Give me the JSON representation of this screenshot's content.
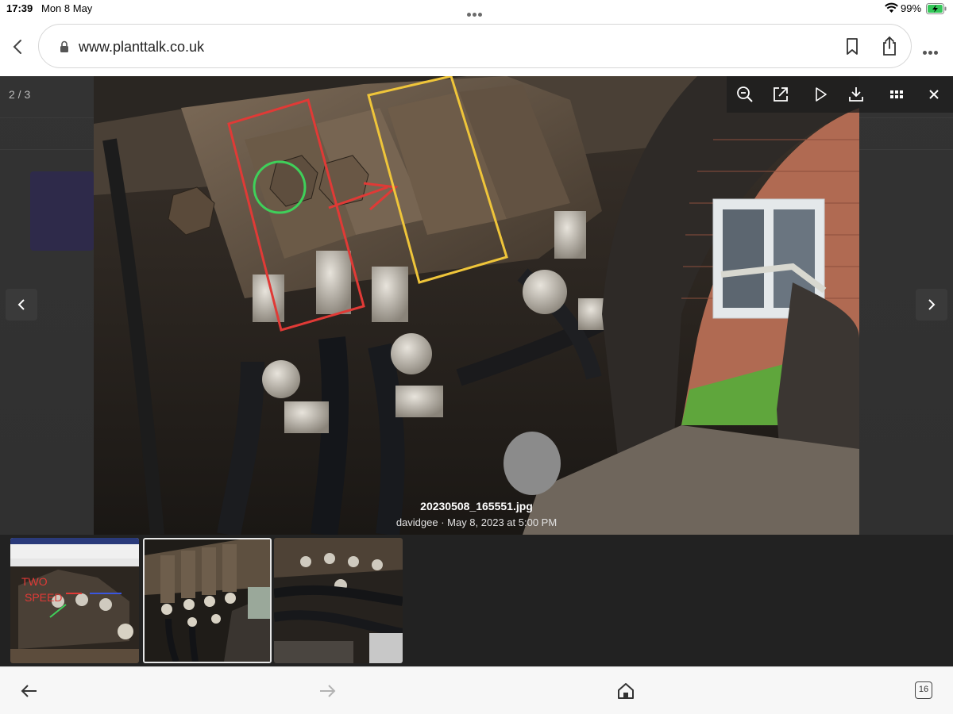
{
  "status_bar": {
    "time": "17:39",
    "date": "Mon 8 May",
    "battery_percent": "99%",
    "battery_level": 0.99,
    "battery_color": "#34c759",
    "wifi_icon": "wifi-icon",
    "battery_icon": "battery-charging-icon"
  },
  "browser": {
    "url": "www.planttalk.co.uk",
    "tab_count": "16",
    "icons": {
      "back": "chevron-left-icon",
      "lock": "lock-icon",
      "bookmark": "bookmark-icon",
      "share": "share-icon",
      "more": "more-dots-icon"
    }
  },
  "lightbox": {
    "counter": "2 / 3",
    "filename": "20230508_165551.jpg",
    "meta": "davidgee · May 8, 2023 at 5:00 PM",
    "toolbar_icons": [
      "zoom-out-icon",
      "open-external-icon",
      "play-icon",
      "download-icon",
      "grid-icon",
      "close-icon"
    ],
    "current_index": 2,
    "total": 3,
    "thumbnails": [
      {
        "id": "thumb-1",
        "handwritten": "TWO SPEED"
      },
      {
        "id": "thumb-2"
      },
      {
        "id": "thumb-3"
      }
    ]
  },
  "annotation_colors": {
    "red_box": "#e03a36",
    "yellow_box": "#efc53a",
    "green_circle": "#3fd05a",
    "red_arrow": "#e03a36"
  },
  "bottom_bar": {
    "icons": [
      "back-arrow-icon",
      "forward-arrow-icon",
      "home-icon",
      "tabs-icon"
    ]
  }
}
